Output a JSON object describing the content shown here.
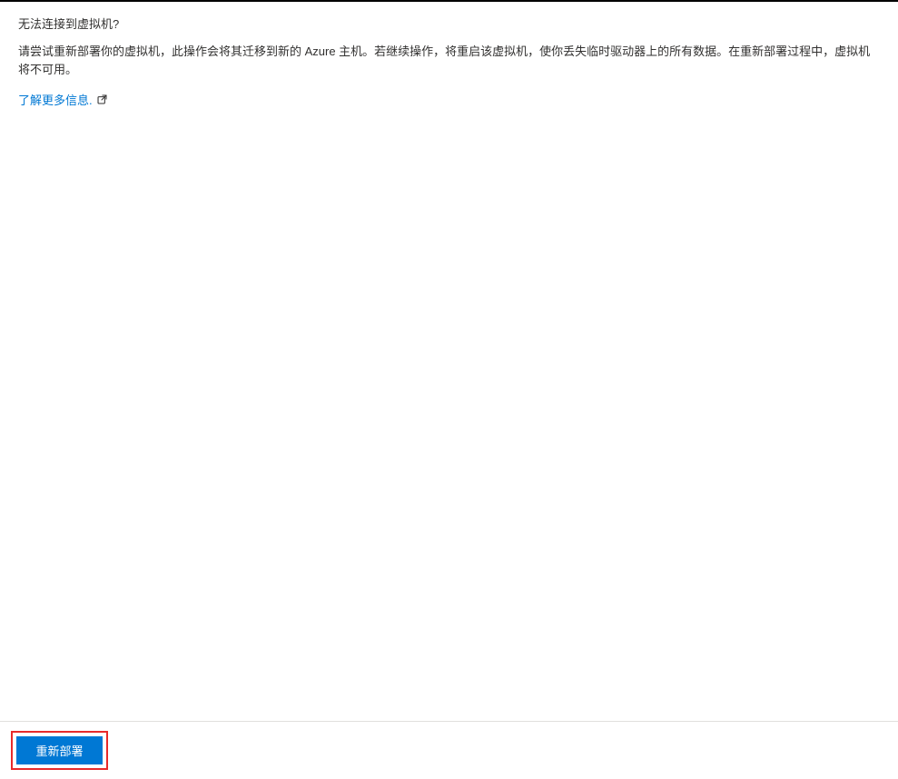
{
  "main": {
    "heading": "无法连接到虚拟机?",
    "description": "请尝试重新部署你的虚拟机，此操作会将其迁移到新的 Azure 主机。若继续操作，将重启该虚拟机，使你丢失临时驱动器上的所有数据。在重新部署过程中，虚拟机将不可用。",
    "learn_more_text": "了解更多信息."
  },
  "footer": {
    "redeploy_label": "重新部署"
  }
}
